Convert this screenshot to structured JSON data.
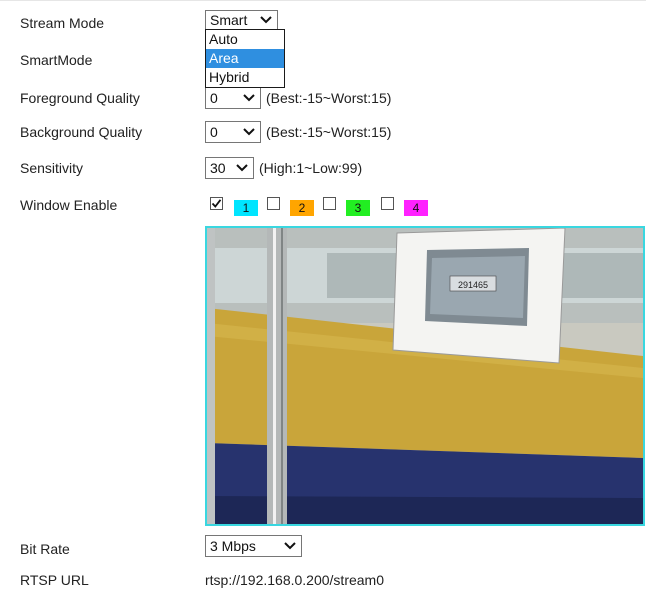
{
  "labels": {
    "stream_mode": "Stream Mode",
    "smart_mode": "SmartMode",
    "foreground_quality": "Foreground Quality",
    "background_quality": "Background Quality",
    "sensitivity": "Sensitivity",
    "window_enable": "Window Enable",
    "bit_rate": "Bit Rate",
    "rtsp_url": "RTSP URL"
  },
  "stream_mode": {
    "selected": "Smart"
  },
  "smart_mode_dropdown": {
    "options": [
      "Auto",
      "Area",
      "Hybrid"
    ],
    "highlighted": "Area"
  },
  "foreground_quality": {
    "value": "0",
    "hint": "(Best:-15~Worst:15)"
  },
  "background_quality": {
    "value": "0",
    "hint": "(Best:-15~Worst:15)"
  },
  "sensitivity": {
    "value": "30",
    "hint": "(High:1~Low:99)"
  },
  "windows": [
    {
      "label": "1",
      "checked": true,
      "color": "#00e5ff"
    },
    {
      "label": "2",
      "checked": false,
      "color": "#ffa500"
    },
    {
      "label": "3",
      "checked": false,
      "color": "#22ee22"
    },
    {
      "label": "4",
      "checked": false,
      "color": "#ff22ff"
    }
  ],
  "video": {
    "plate_text": "291465",
    "border_color": "#39d7e0"
  },
  "bit_rate": {
    "value": "3 Mbps"
  },
  "rtsp_url": {
    "value": "rtsp://192.168.0.200/stream0"
  }
}
